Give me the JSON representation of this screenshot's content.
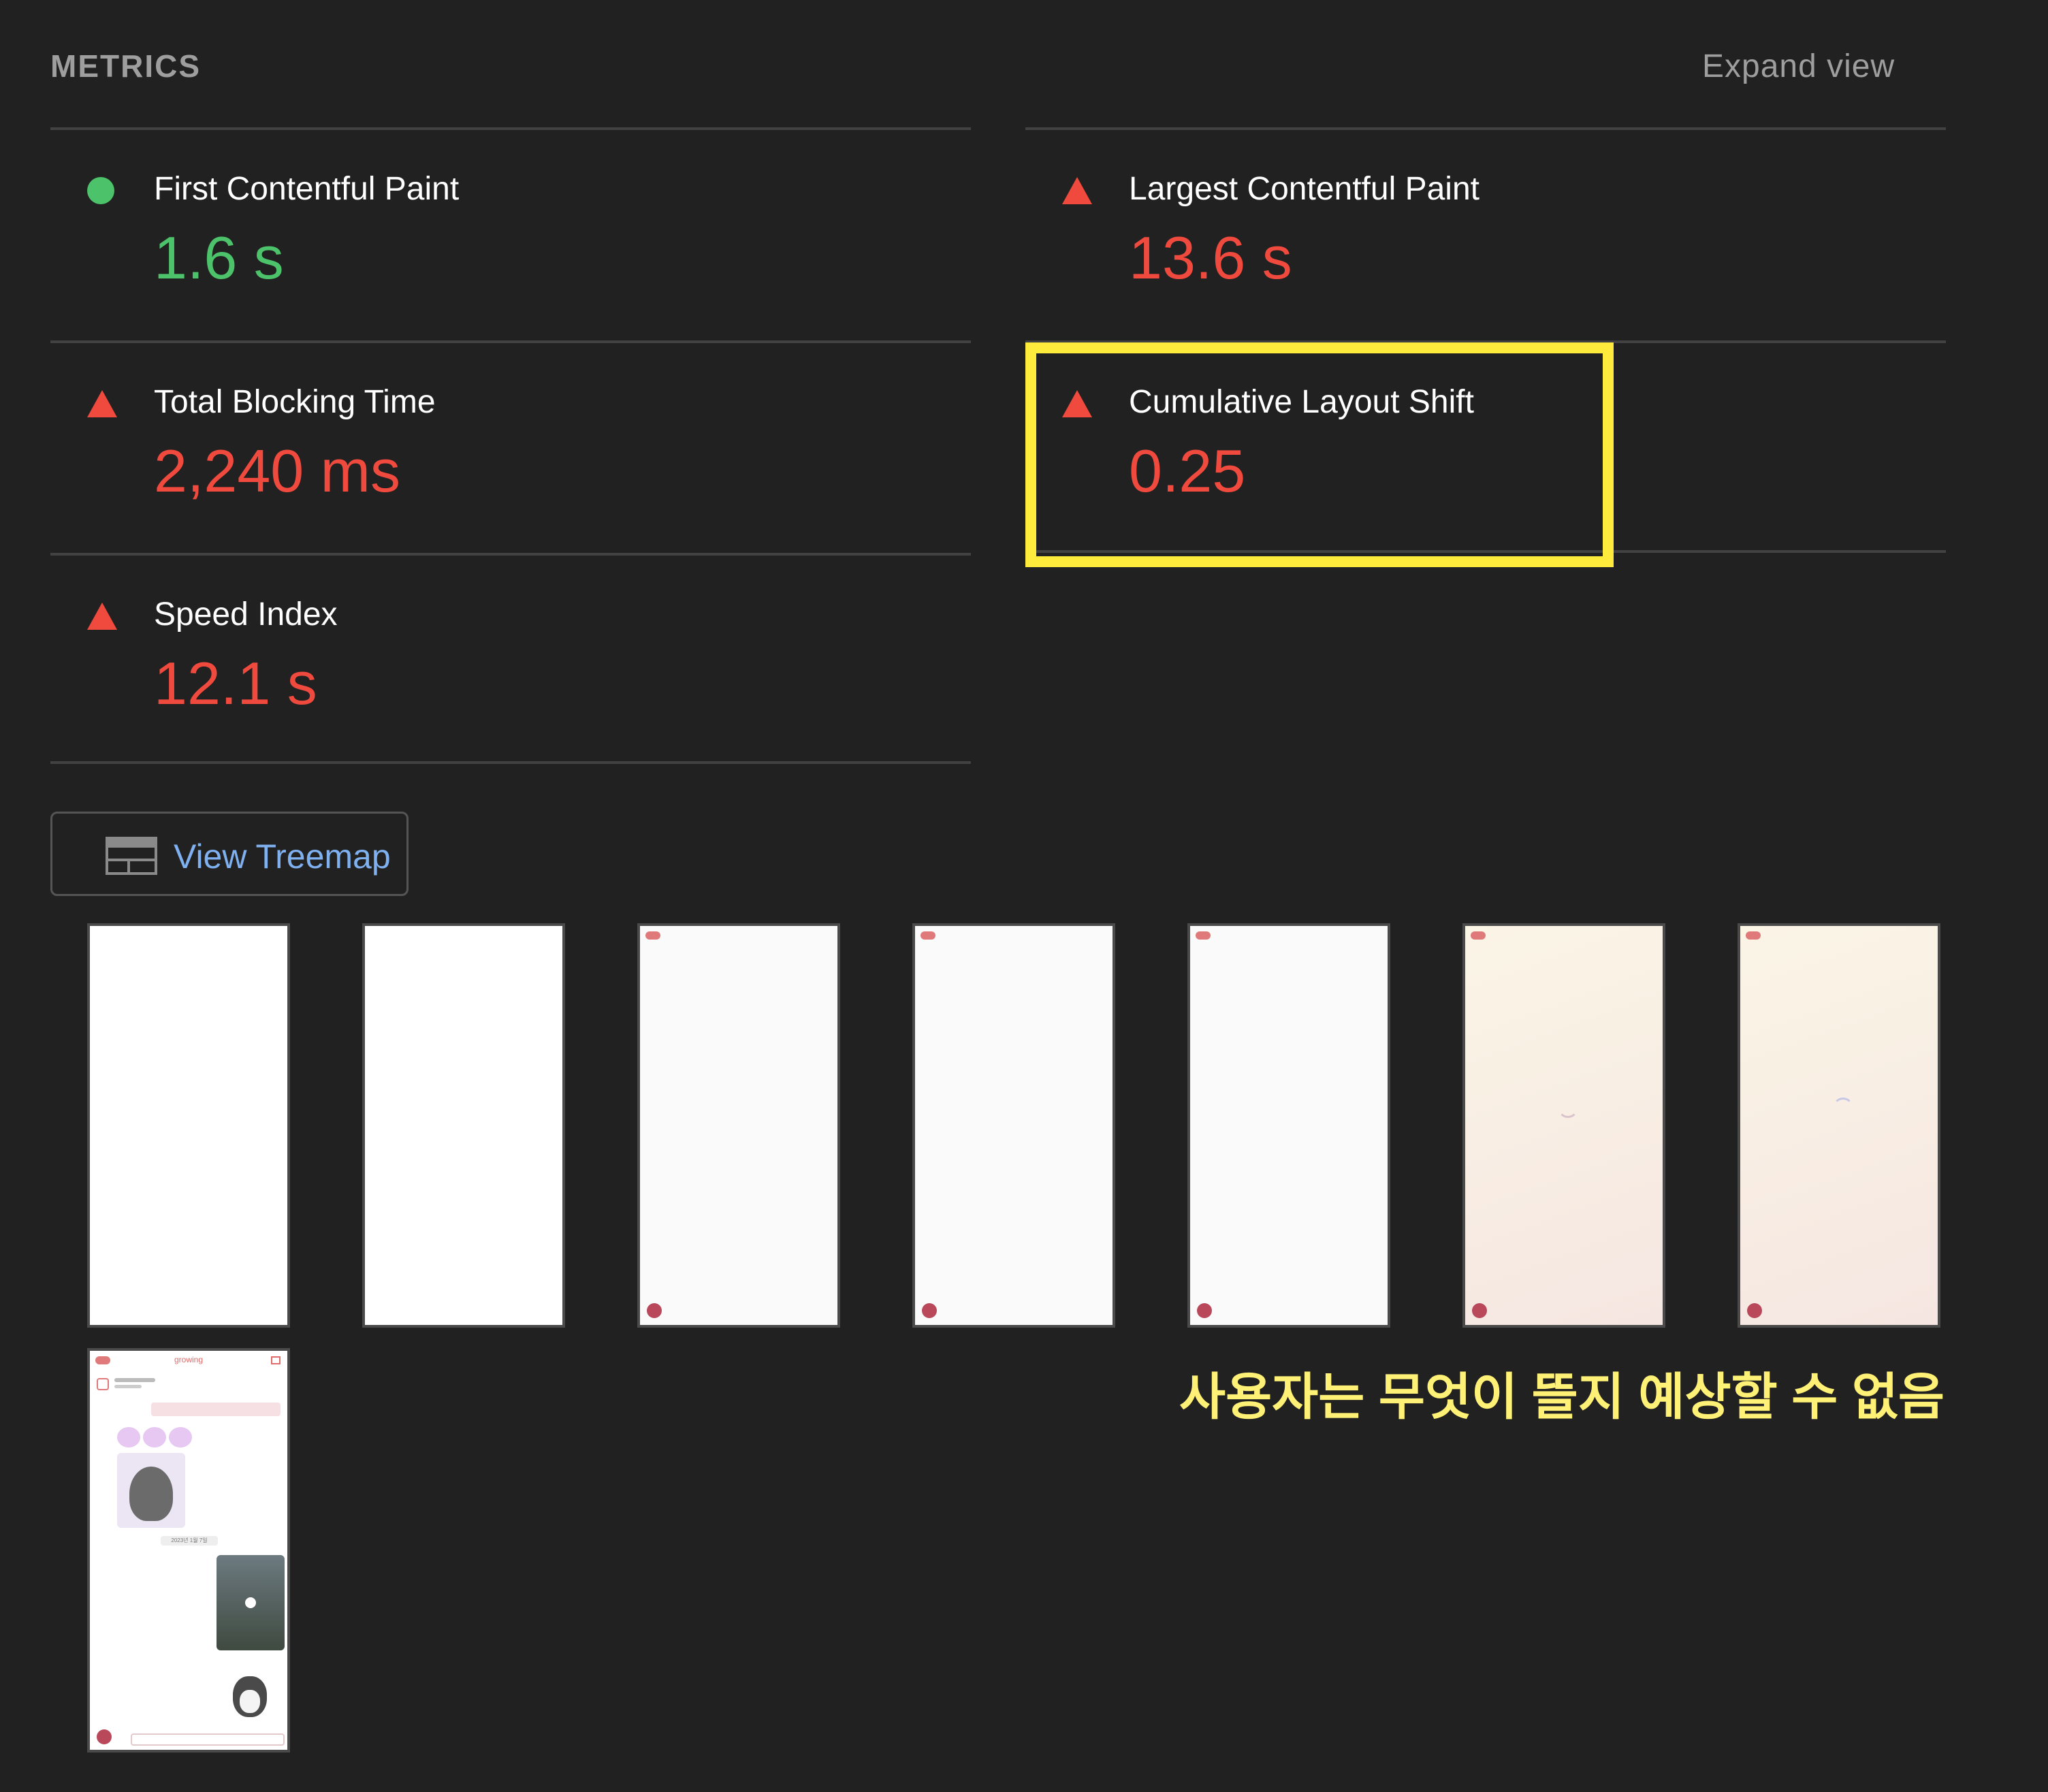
{
  "header": {
    "section_title": "METRICS",
    "expand_label": "Expand view"
  },
  "metrics": [
    {
      "label": "First Contentful Paint",
      "value": "1.6 s",
      "status": "pass",
      "color": "#4cc26a"
    },
    {
      "label": "Largest Contentful Paint",
      "value": "13.6 s",
      "status": "fail",
      "color": "#f04a3e"
    },
    {
      "label": "Total Blocking Time",
      "value": "2,240 ms",
      "status": "fail",
      "color": "#f04a3e"
    },
    {
      "label": "Cumulative Layout Shift",
      "value": "0.25",
      "status": "fail",
      "color": "#f04a3e"
    },
    {
      "label": "Speed Index",
      "value": "12.1 s",
      "status": "fail",
      "color": "#f04a3e"
    }
  ],
  "treemap": {
    "label": "View Treemap",
    "icon": "treemap-icon"
  },
  "filmstrip": {
    "frames": [
      {
        "style": "white"
      },
      {
        "style": "white"
      },
      {
        "style": "light"
      },
      {
        "style": "light"
      },
      {
        "style": "light"
      },
      {
        "style": "warm"
      },
      {
        "style": "warm"
      }
    ],
    "final_frame": {
      "app_title": "growing",
      "date_chip": "2023년 1월 7일"
    }
  },
  "annotation": {
    "caption": "사용자는 무엇이 뜰지 예상할 수 없음",
    "highlight_color": "#ffeb3b"
  }
}
